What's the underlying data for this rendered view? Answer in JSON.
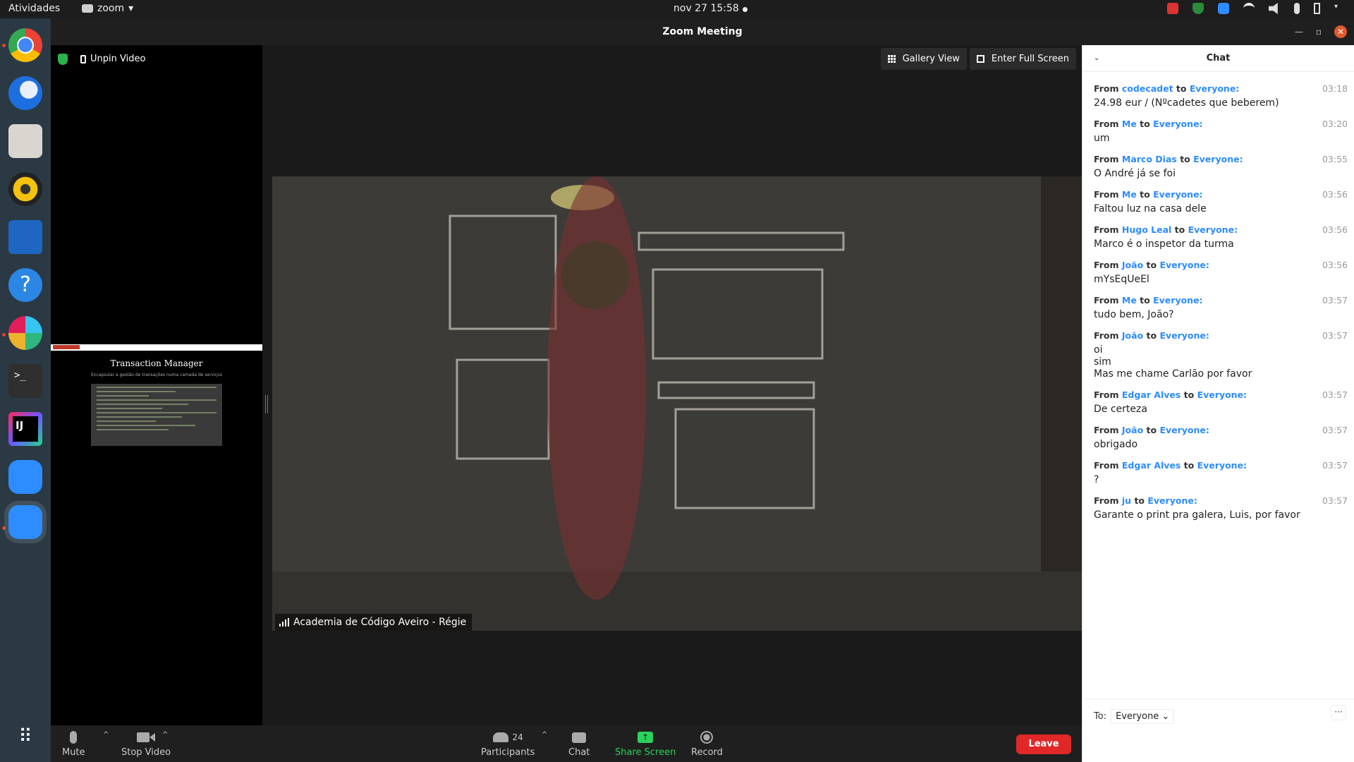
{
  "topbar": {
    "activities": "Atividades",
    "app_name": "zoom",
    "clock": "nov 27  15:58"
  },
  "dock": {
    "apps": [
      "chrome-icon",
      "thunderbird-icon",
      "files-icon",
      "rhythmbox-icon",
      "writer-icon",
      "help-icon",
      "slack-icon",
      "terminal-icon",
      "intellij-icon",
      "zoom-icon",
      "zoom-active-icon"
    ]
  },
  "window": {
    "title": "Zoom Meeting"
  },
  "left_pane": {
    "unpin_label": "Unpin Video",
    "slide_title": "Transaction Manager",
    "slide_subtitle": "Encapsular a gestão de transações numa camada de serviços"
  },
  "view": {
    "gallery_label": "Gallery View",
    "fullscreen_label": "Enter Full Screen"
  },
  "video": {
    "speaker_name": "Academia de Código Aveiro - Régie"
  },
  "chat": {
    "title": "Chat",
    "from_word": "From",
    "to_word": "to",
    "messages": [
      {
        "sender": "codecadet",
        "recipient": "Everyone:",
        "time": "03:18",
        "text": "24.98 eur / (Nºcadetes que beberem)"
      },
      {
        "sender": "Me",
        "recipient": "Everyone:",
        "time": "03:20",
        "text": "um"
      },
      {
        "sender": "Marco Dias",
        "recipient": "Everyone:",
        "time": "03:55",
        "text": "O André já se foi"
      },
      {
        "sender": "Me",
        "recipient": "Everyone:",
        "time": "03:56",
        "text": "Faltou luz na casa dele"
      },
      {
        "sender": "Hugo Leal",
        "recipient": "Everyone:",
        "time": "03:56",
        "text": "Marco é o inspetor da turma"
      },
      {
        "sender": "João",
        "recipient": "Everyone:",
        "time": "03:56",
        "text": "mYsEqUeEl"
      },
      {
        "sender": "Me",
        "recipient": "Everyone:",
        "time": "03:57",
        "text": "tudo bem, João?"
      },
      {
        "sender": "João",
        "recipient": "Everyone:",
        "time": "03:57",
        "lines": [
          "oi",
          "sim",
          "Mas me chame Carlão por favor"
        ]
      },
      {
        "sender": "Edgar Alves",
        "recipient": "Everyone:",
        "time": "03:57",
        "text": "De certeza"
      },
      {
        "sender": "João",
        "recipient": "Everyone:",
        "time": "03:57",
        "text": "obrigado"
      },
      {
        "sender": "Edgar Alves",
        "recipient": "Everyone:",
        "time": "03:57",
        "text": "?"
      },
      {
        "sender": "ju",
        "recipient": "Everyone:",
        "time": "03:57",
        "text": "Garante o print pra galera, Luis, por favor"
      }
    ],
    "to_label": "To:",
    "to_value": "Everyone",
    "more_label": "···"
  },
  "toolbar": {
    "mute": "Mute",
    "stop_video": "Stop Video",
    "participants": "Participants",
    "participants_count": "24",
    "chat": "Chat",
    "share_screen": "Share Screen",
    "record": "Record",
    "leave": "Leave"
  },
  "colors": {
    "accent_blue": "#2d8cff",
    "leave_red": "#e02828",
    "share_green": "#2bd15a"
  }
}
